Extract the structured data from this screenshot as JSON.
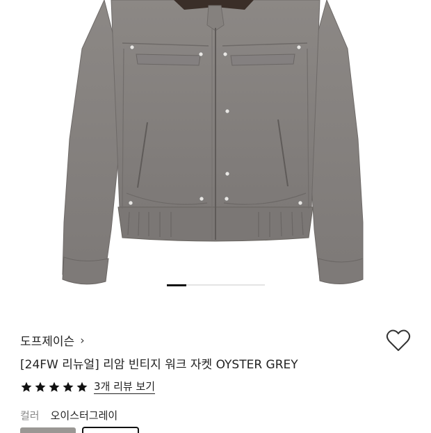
{
  "product": {
    "brand": "도프제이슨",
    "brand_chevron": "›",
    "title": "[24FW 리뉴얼] 리암 빈티지 워크 자켓 OYSTER GREY",
    "rating_stars": 5,
    "review_link": "3개 리뷰 보기",
    "color_label": "컬러",
    "color_value": "오이스터그레이"
  },
  "gallery": {
    "total_slides": 5,
    "current_slide": 1
  },
  "colors": {
    "jacket": "#8a8683",
    "jacket_shadow": "#6f6b69",
    "collar": "#3a2e28",
    "star": "#111111",
    "swatch_oyster": "#9a9794"
  },
  "icons": {
    "wishlist": "heart-outline-icon",
    "brand_link": "chevron-right-icon",
    "rating": "star-icon"
  }
}
